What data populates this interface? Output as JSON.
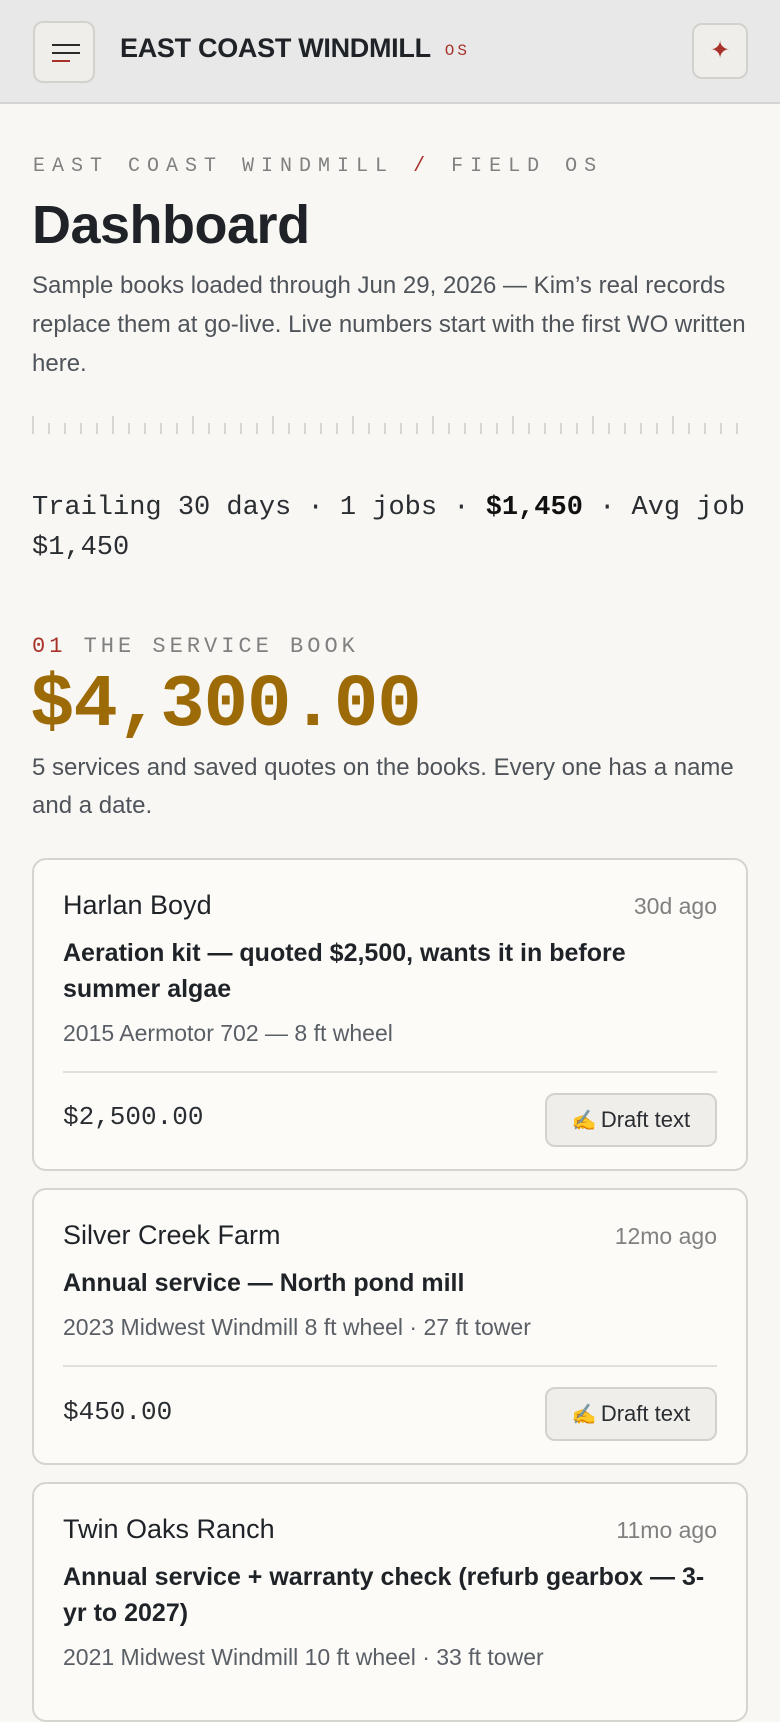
{
  "header": {
    "brand": "EAST COAST WINDMILL",
    "brand_suffix": "OS",
    "menu_icon": "hamburger-menu-icon",
    "action_icon": "sparkle-icon",
    "action_glyph": "✦"
  },
  "breadcrumb": {
    "part1": "EAST COAST WINDMILL",
    "separator": "/",
    "part2": "FIELD OS"
  },
  "page": {
    "title": "Dashboard",
    "intro": "Sample books loaded through Jun 29, 2026 — Kim’s real records replace them at go-live. Live numbers start with the first WO written here."
  },
  "trailing": {
    "prefix": "Trailing 30 days · 1 jobs · ",
    "revenue": "$1,450",
    "suffix": " · Avg job $1,450"
  },
  "service_book": {
    "number": "01",
    "label": "THE SERVICE BOOK",
    "total": "$4,300.00",
    "note": "5 services and saved quotes on the books. Every one has a name and a date."
  },
  "cards": [
    {
      "name": "Harlan Boyd",
      "age": "30d ago",
      "title": "Aeration kit — quoted $2,500, wants it in before summer algae",
      "sub": "2015 Aermotor 702 — 8 ft wheel",
      "amount": "$2,500.00",
      "button_icon": "✍️",
      "button_label": "Draft text"
    },
    {
      "name": "Silver Creek Farm",
      "age": "12mo ago",
      "title": "Annual service — North pond mill",
      "sub": "2023 Midwest Windmill 8 ft wheel · 27 ft tower",
      "amount": "$450.00",
      "button_icon": "✍️",
      "button_label": "Draft text"
    },
    {
      "name": "Twin Oaks Ranch",
      "age": "11mo ago",
      "title": "Annual service + warranty check (refurb gearbox — 3-yr to 2027)",
      "sub": "2021 Midwest Windmill 10 ft wheel · 33 ft tower"
    }
  ]
}
